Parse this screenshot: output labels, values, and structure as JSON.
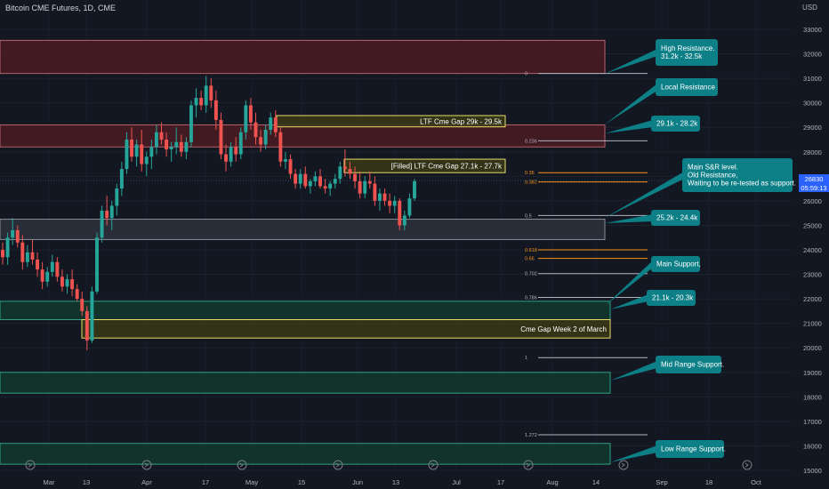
{
  "header": {
    "title": "Bitcoin CME Futures, 1D, CME",
    "currency": "USD"
  },
  "last_price": {
    "value": "26830",
    "countdown": "05:59:13"
  },
  "colors": {
    "background": "#131722",
    "up": "#26a69a",
    "down": "#ef5350",
    "callout": "#0d7f86",
    "resistance_zone": "#4a1f25",
    "support_zone": "#12382e",
    "gap_zone": "#3a3a1a",
    "neutral_zone": "#2b2f3a"
  },
  "chart_data": {
    "type": "candlestick",
    "title": "Bitcoin CME Futures, 1D, CME",
    "y_axis": {
      "ticks": [
        15000,
        16000,
        17000,
        18000,
        19000,
        20000,
        21000,
        22000,
        23000,
        24000,
        25000,
        26000,
        27000,
        28000,
        29000,
        30000,
        31000,
        32000,
        33000
      ],
      "range": [
        14800,
        33700
      ],
      "side": "right"
    },
    "x_axis": {
      "ticks": [
        "Mar",
        "13",
        "Apr",
        "17",
        "May",
        "15",
        "Jun",
        "13",
        "Jul",
        "17",
        "Aug",
        "14",
        "Sep",
        "18",
        "Oct"
      ]
    },
    "zones": [
      {
        "label": "High Resistance. 31.2k - 32.5k",
        "low": 31200,
        "high": 32550,
        "kind": "resistance"
      },
      {
        "label": "29.1k - 28.2k",
        "low": 28200,
        "high": 29100,
        "kind": "resistance"
      },
      {
        "label": "LTF  Cme Gap 29k - 29.5k",
        "low": 29020,
        "high": 29480,
        "kind": "gap"
      },
      {
        "label": "[Filled] LTF Cme Gap 27.1k - 27.7k",
        "low": 27150,
        "high": 27700,
        "kind": "gap"
      },
      {
        "label": "25.2k - 24.4k",
        "low": 24420,
        "high": 25250,
        "kind": "neutral"
      },
      {
        "label": "21.1k - 20.3k",
        "low": 21150,
        "high": 21900,
        "kind": "support"
      },
      {
        "label": "Cme Gap Week 2 of March",
        "low": 20400,
        "high": 21150,
        "kind": "gap"
      },
      {
        "label": "Mid Range Support.",
        "low": 18150,
        "high": 19000,
        "kind": "support"
      },
      {
        "label": "Low Range Support.",
        "low": 15250,
        "high": 16100,
        "kind": "support"
      }
    ],
    "fib_levels": [
      {
        "label": "0",
        "price": 31200
      },
      {
        "label": "0.236",
        "price": 28450
      },
      {
        "label": "0.35",
        "price": 27150
      },
      {
        "label": "0.382",
        "price": 26770
      },
      {
        "label": "0.5",
        "price": 25400
      },
      {
        "label": "0.618",
        "price": 24000
      },
      {
        "label": "0.65",
        "price": 23650
      },
      {
        "label": "0.702",
        "price": 23030
      },
      {
        "label": "0.786",
        "price": 22060
      },
      {
        "label": "1",
        "price": 19600
      },
      {
        "label": "1.272",
        "price": 16450
      }
    ],
    "candles": [
      [
        24000,
        24300,
        23400,
        23700
      ],
      [
        23700,
        24700,
        23400,
        24500
      ],
      [
        24500,
        25300,
        24200,
        24800
      ],
      [
        24800,
        25000,
        24100,
        24300
      ],
      [
        24300,
        24600,
        23200,
        23500
      ],
      [
        23500,
        24200,
        23300,
        23900
      ],
      [
        23900,
        24400,
        23400,
        23600
      ],
      [
        23600,
        23900,
        22900,
        23200
      ],
      [
        23200,
        23500,
        22400,
        22700
      ],
      [
        22700,
        23300,
        22500,
        23100
      ],
      [
        23100,
        23800,
        22900,
        23500
      ],
      [
        23500,
        23700,
        22700,
        22900
      ],
      [
        22900,
        23200,
        22300,
        22500
      ],
      [
        22500,
        23000,
        22200,
        22800
      ],
      [
        22800,
        23200,
        22100,
        22400
      ],
      [
        22400,
        22600,
        21900,
        22000
      ],
      [
        22000,
        22300,
        21300,
        21500
      ],
      [
        21500,
        21700,
        19900,
        20300
      ],
      [
        20300,
        22500,
        20200,
        22300
      ],
      [
        22300,
        24700,
        22200,
        24500
      ],
      [
        24500,
        25800,
        24300,
        25600
      ],
      [
        25600,
        26200,
        25000,
        25300
      ],
      [
        25300,
        26000,
        24800,
        25800
      ],
      [
        25800,
        26700,
        25400,
        26500
      ],
      [
        26500,
        27600,
        26200,
        27300
      ],
      [
        27300,
        28800,
        27100,
        28500
      ],
      [
        28500,
        29000,
        27600,
        27800
      ],
      [
        27800,
        28500,
        27400,
        28300
      ],
      [
        28300,
        28900,
        27200,
        27500
      ],
      [
        27500,
        28000,
        27000,
        27800
      ],
      [
        27800,
        28500,
        27300,
        28200
      ],
      [
        28200,
        29100,
        27900,
        28800
      ],
      [
        28800,
        29200,
        28300,
        28500
      ],
      [
        28500,
        28800,
        27800,
        28100
      ],
      [
        28100,
        28400,
        27600,
        28200
      ],
      [
        28200,
        29000,
        27900,
        28400
      ],
      [
        28400,
        28700,
        27800,
        28000
      ],
      [
        28000,
        28600,
        27700,
        28400
      ],
      [
        28400,
        30100,
        28200,
        29900
      ],
      [
        29900,
        30600,
        29400,
        30200
      ],
      [
        30200,
        30500,
        29700,
        29900
      ],
      [
        29900,
        31100,
        29600,
        30700
      ],
      [
        30700,
        31000,
        29800,
        30100
      ],
      [
        30100,
        30500,
        28900,
        29300
      ],
      [
        29300,
        29600,
        27700,
        27900
      ],
      [
        27900,
        28300,
        27200,
        27600
      ],
      [
        27600,
        28400,
        27400,
        28200
      ],
      [
        28200,
        28600,
        27600,
        27900
      ],
      [
        27900,
        29000,
        27700,
        28800
      ],
      [
        28800,
        30100,
        28500,
        29900
      ],
      [
        29900,
        30200,
        28900,
        29200
      ],
      [
        29200,
        29600,
        28300,
        28600
      ],
      [
        28600,
        28900,
        28000,
        28300
      ],
      [
        28300,
        29100,
        28100,
        28900
      ],
      [
        28900,
        29600,
        28700,
        29400
      ],
      [
        29400,
        29700,
        28600,
        28800
      ],
      [
        28800,
        29000,
        27400,
        27600
      ],
      [
        27600,
        28000,
        27300,
        27700
      ],
      [
        27700,
        27900,
        26900,
        27100
      ],
      [
        27100,
        27300,
        26500,
        26700
      ],
      [
        26700,
        27300,
        26500,
        27100
      ],
      [
        27100,
        27400,
        26500,
        26600
      ],
      [
        26600,
        26900,
        26300,
        26800
      ],
      [
        26800,
        27200,
        26600,
        27000
      ],
      [
        27000,
        27300,
        26500,
        26600
      ],
      [
        26600,
        26900,
        26300,
        26500
      ],
      [
        26500,
        26800,
        26200,
        26700
      ],
      [
        26700,
        27100,
        26500,
        26900
      ],
      [
        26900,
        27600,
        26700,
        27400
      ],
      [
        27400,
        28100,
        27000,
        27300
      ],
      [
        27300,
        27600,
        26900,
        27100
      ],
      [
        27100,
        27400,
        26500,
        26800
      ],
      [
        26800,
        27200,
        26100,
        26300
      ],
      [
        26300,
        27000,
        26100,
        26800
      ],
      [
        26800,
        27200,
        26500,
        26700
      ],
      [
        26700,
        27000,
        25800,
        26000
      ],
      [
        26000,
        26500,
        25600,
        26300
      ],
      [
        26300,
        26500,
        25800,
        26000
      ],
      [
        26000,
        26300,
        25500,
        25800
      ],
      [
        25800,
        26200,
        25500,
        26000
      ],
      [
        26000,
        26100,
        24800,
        25000
      ],
      [
        25000,
        25600,
        24800,
        25400
      ],
      [
        25400,
        26300,
        25300,
        26100
      ],
      [
        26100,
        26900,
        26000,
        26800
      ]
    ]
  },
  "annotations": {
    "high_resistance": "High Resistance.\n31.2k - 32.5k",
    "local_resistance": "Local Resistance",
    "r_29": "29.1k - 28.2k",
    "main_sbr": "Main S&R level.\nOld Resistance,\nWaiting to be re-tested as support.",
    "s_25": "25.2k - 24.4k",
    "main_support": "Main Support,",
    "s_21": "21.1k - 20.3k",
    "mid_support": "Mid Range Support.",
    "low_support": "Low Range Support."
  }
}
